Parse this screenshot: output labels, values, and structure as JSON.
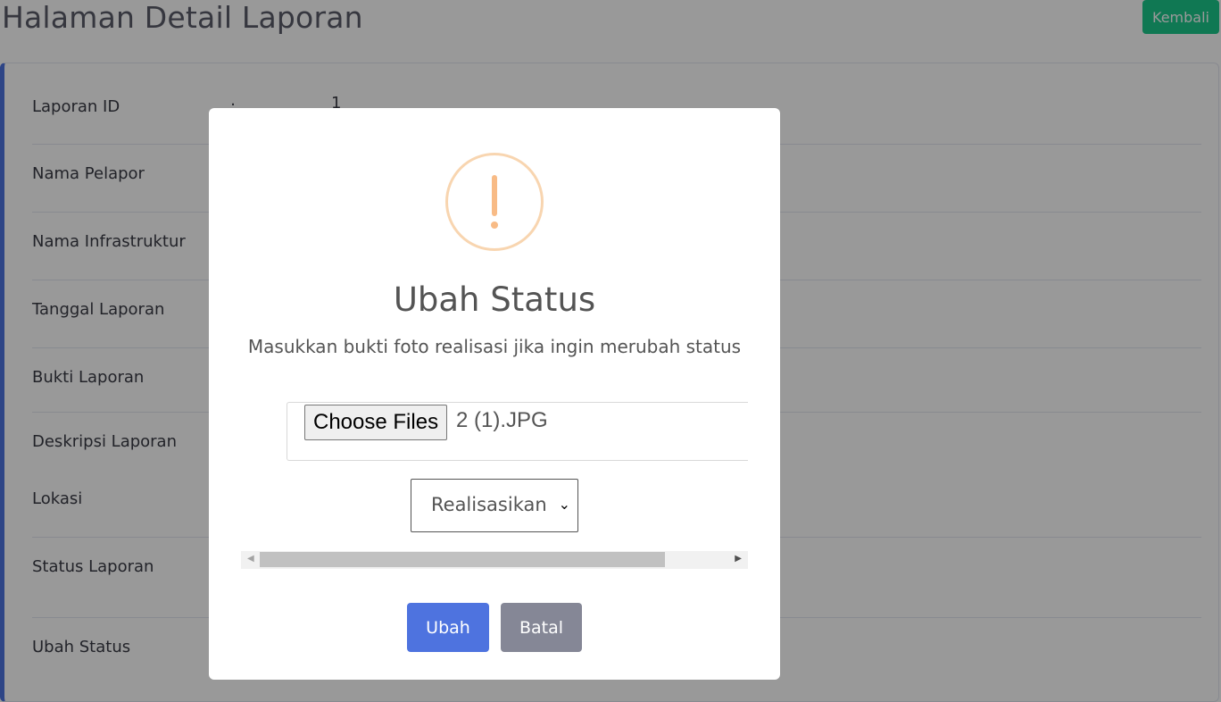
{
  "page": {
    "title": "Halaman Detail Laporan",
    "back_label": "Kembali"
  },
  "details": {
    "separator": ":",
    "rows": [
      {
        "label": "Laporan ID",
        "value": "1"
      },
      {
        "label": "Nama Pelapor",
        "value": ""
      },
      {
        "label": "Nama Infrastruktur",
        "value": ""
      },
      {
        "label": "Tanggal Laporan",
        "value": ""
      },
      {
        "label": "Bukti Laporan",
        "value": ""
      },
      {
        "label": "Deskripsi Laporan",
        "value": ""
      },
      {
        "label": "Lokasi",
        "value": ""
      },
      {
        "label": "Status Laporan",
        "value": ""
      },
      {
        "label": "Ubah Status",
        "value": ""
      }
    ]
  },
  "modal": {
    "icon": "warning-icon",
    "title": "Ubah Status",
    "text": "Masukkan bukti foto realisasi jika ingin merubah status",
    "file_button_label": "Choose Files",
    "file_name": "2 (1).JPG",
    "select_value": "Realisasikan",
    "confirm_label": "Ubah",
    "cancel_label": "Batal"
  },
  "colors": {
    "primary": "#4e73df",
    "success": "#1cc88a",
    "secondary": "#858796",
    "warning_icon": "#f8bb86"
  }
}
